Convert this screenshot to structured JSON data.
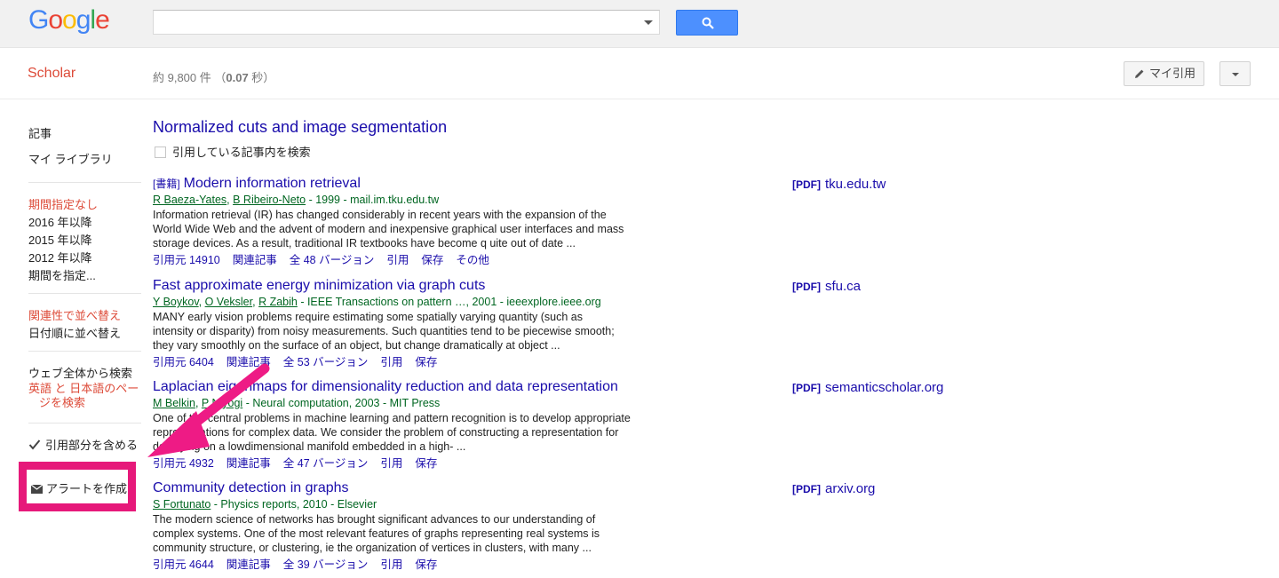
{
  "header": {
    "logo_letters": [
      {
        "ch": "G",
        "color": "#4285f4"
      },
      {
        "ch": "o",
        "color": "#ea4335"
      },
      {
        "ch": "o",
        "color": "#fbbc05"
      },
      {
        "ch": "g",
        "color": "#4285f4"
      },
      {
        "ch": "l",
        "color": "#34a853"
      },
      {
        "ch": "e",
        "color": "#ea4335"
      }
    ],
    "search_value": "",
    "search_icon": "search-icon"
  },
  "subbar": {
    "scholar_label": "Scholar",
    "stats_prefix": "約 9,800 件 （",
    "stats_time": "0.07",
    "stats_suffix": " 秒）",
    "my_citations_label": "マイ引用",
    "my_citations_icon": "pencil-icon",
    "menu_icon": "chevron-down-icon"
  },
  "sidebar": {
    "articles": "記事",
    "my_library": "マイ ライブラリ",
    "time_any": "期間指定なし",
    "since_2016": "2016 年以降",
    "since_2015": "2015 年以降",
    "since_2012": "2012 年以降",
    "custom_range": "期間を指定...",
    "sort_relevance": "関連性で並べ替え",
    "sort_date": "日付順に並べ替え",
    "search_web": "ウェブ全体から検索",
    "search_lang_line1": "英語 と 日本語のペー",
    "search_lang_line2": "ジを検索",
    "include_citations": "引用部分を含める",
    "create_alert": "アラートを作成"
  },
  "cited": {
    "title": "Normalized cuts and image segmentation",
    "search_within": "引用している記事内を検索"
  },
  "results": [
    {
      "tag": "[書籍]",
      "title": "Modern information retrieval",
      "authors": [
        "R Baeza-Yates",
        "B Ribeiro-Neto"
      ],
      "source": " - 1999 - mail.im.tku.edu.tw",
      "snippet": "Information retrieval (IR) has changed considerably in recent years with the expansion of the World Wide Web and the advent of modern and inexpensive graphical user interfaces and mass storage devices. As a result, traditional IR textbooks have become q uite out of date ...",
      "links": [
        "引用元 14910",
        "関連記事",
        "全 48 バージョン",
        "引用",
        "保存",
        "その他"
      ],
      "pdf_tag": "[PDF]",
      "pdf_domain": "tku.edu.tw"
    },
    {
      "tag": "",
      "title": "Fast approximate energy minimization via graph cuts",
      "authors": [
        "Y Boykov",
        "O Veksler",
        "R Zabih"
      ],
      "source": " - IEEE Transactions on pattern …, 2001 - ieeexplore.ieee.org",
      "snippet": "MANY early vision problems require estimating some spatially varying quantity (such as intensity or disparity) from noisy measurements. Such quantities tend to be piecewise smooth; they vary smoothly on the surface of an object, but change dramatically at object ...",
      "links": [
        "引用元 6404",
        "関連記事",
        "全 53 バージョン",
        "引用",
        "保存"
      ],
      "pdf_tag": "[PDF]",
      "pdf_domain": "sfu.ca"
    },
    {
      "tag": "",
      "title": "Laplacian eigenmaps for dimensionality reduction and data representation",
      "authors": [
        "M Belkin",
        "P Niyogi"
      ],
      "source": " - Neural computation, 2003 - MIT Press",
      "snippet": "One of the central problems in machine learning and pattern recognition is to develop appropriate representations for complex data. We consider the problem of constructing a representation for data lying on a lowdimensional manifold embedded in a high- ...",
      "links": [
        "引用元 4932",
        "関連記事",
        "全 47 バージョン",
        "引用",
        "保存"
      ],
      "pdf_tag": "[PDF]",
      "pdf_domain": "semanticscholar.org"
    },
    {
      "tag": "",
      "title": "Community detection in graphs",
      "authors": [
        "S Fortunato"
      ],
      "source": " - Physics reports, 2010 - Elsevier",
      "snippet": "The modern science of networks has brought significant advances to our understanding of complex systems. One of the most relevant features of graphs representing real systems is community structure, or clustering, ie the organization of vertices in clusters, with many ...",
      "links": [
        "引用元 4644",
        "関連記事",
        "全 39 バージョン",
        "引用",
        "保存"
      ],
      "pdf_tag": "[PDF]",
      "pdf_domain": "arxiv.org"
    }
  ],
  "annotation": {
    "highlight_color": "#e6197a",
    "arrow_color": "#ee1b85"
  }
}
